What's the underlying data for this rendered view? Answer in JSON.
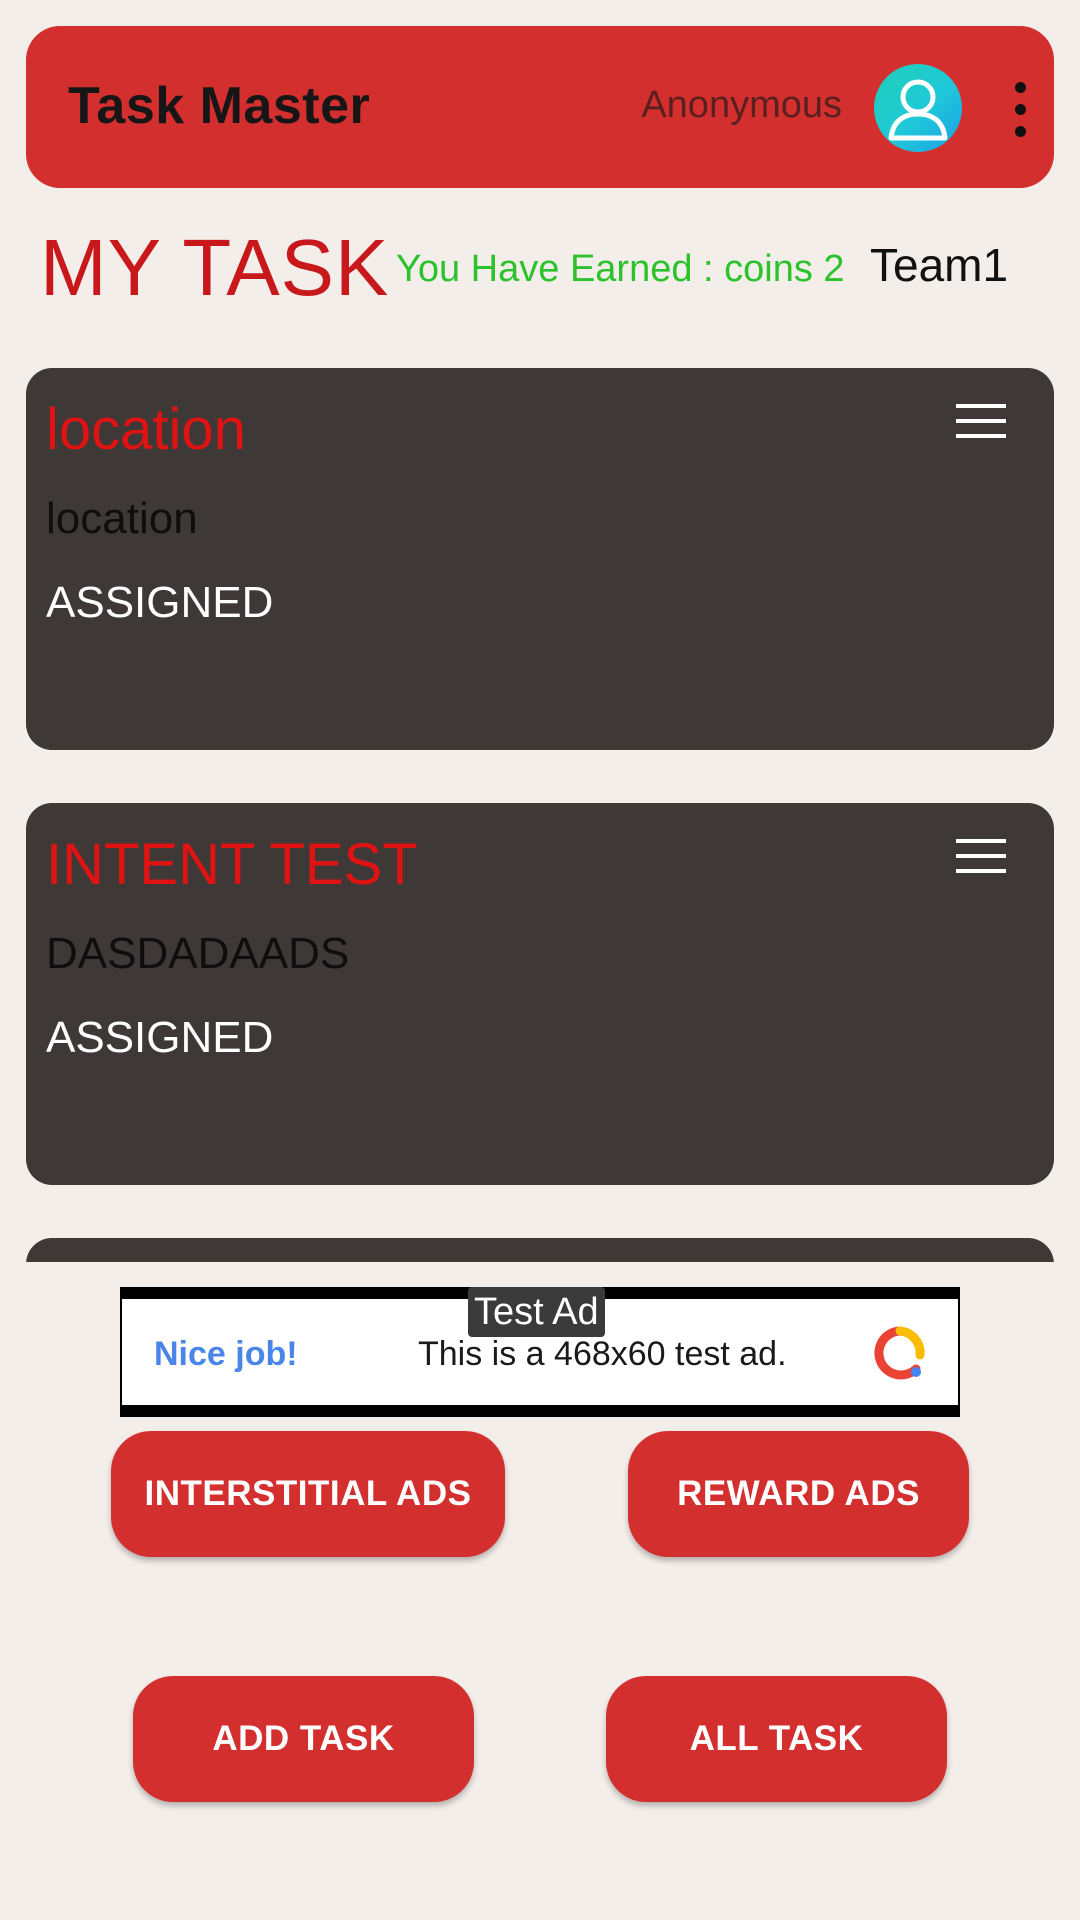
{
  "app_bar": {
    "title": "Task Master",
    "user_name": "Anonymous",
    "avatar_icon": "user-avatar-icon",
    "menu_icon": "more-vert-icon"
  },
  "heading": {
    "title": "MY TASK",
    "earned": "You Have Earned : coins 2",
    "team": "Team1"
  },
  "tasks": [
    {
      "title": "location",
      "description": "location",
      "status": "ASSIGNED"
    },
    {
      "title": "INTENT TEST",
      "description": "DASDADAADS",
      "status": "ASSIGNED"
    }
  ],
  "ad": {
    "label": "Test Ad",
    "headline": "Nice job!",
    "text": "This is a 468x60 test ad."
  },
  "buttons": {
    "interstitial": "INTERSTITIAL ADS",
    "reward": "REWARD ADS",
    "add_task": "ADD TASK",
    "all_task": "ALL TASK"
  },
  "colors": {
    "primary": "#d32f2f",
    "background": "#f3eeea",
    "card": "#3e3837",
    "heading": "#c8181b",
    "earned": "#2cc22c"
  }
}
